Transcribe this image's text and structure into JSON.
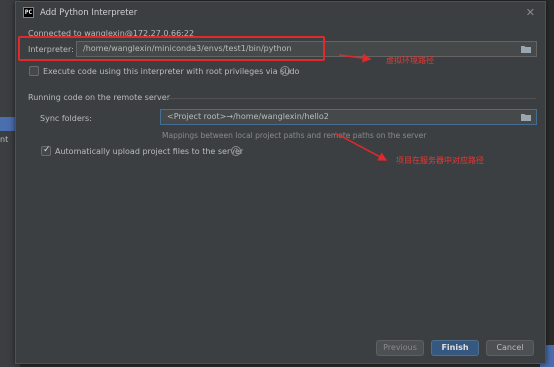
{
  "dialog": {
    "title": "Add Python Interpreter",
    "app_icon": "PC",
    "connected": "Connected to wanglexin@172.27.0.66:22"
  },
  "interpreter": {
    "label": "Interpreter:",
    "value": "/home/wanglexin/miniconda3/envs/test1/bin/python"
  },
  "sudo": {
    "label": "Execute code using this interpreter with root privileges via sudo",
    "checked": false
  },
  "remote": {
    "section_title": "Running code on the remote server",
    "sync_label": "Sync folders:",
    "sync_value": "<Project root>→/home/wanglexin/hello2",
    "sync_hint": "Mappings between local project paths and remote paths on the server",
    "auto_upload_label": "Automatically upload project files to the server",
    "auto_upload_checked": true
  },
  "annotations": {
    "env_note": "虚拟环境路径",
    "server_note": "项目在服务器中对应路径"
  },
  "buttons": {
    "previous": "Previous",
    "finish": "Finish",
    "cancel": "Cancel"
  },
  "colors": {
    "accent": "#365880",
    "annotation": "#e0292b",
    "background": "#3c3f41"
  },
  "icons": {
    "close": "close-icon",
    "folder": "folder-icon",
    "help": "help-icon",
    "checkmark": "checkmark-icon"
  }
}
